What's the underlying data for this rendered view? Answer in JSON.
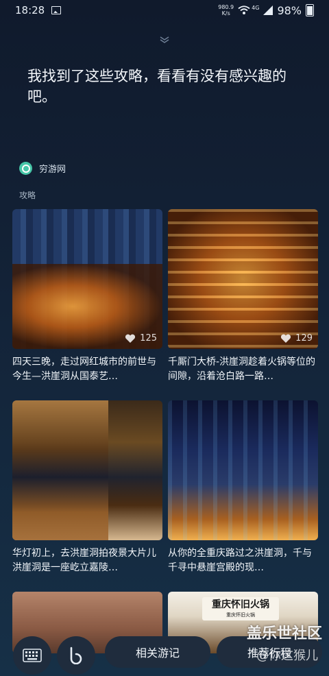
{
  "status_bar": {
    "time": "18:28",
    "net_speed_value": "980.9",
    "net_speed_unit": "K/s",
    "network_type": "4G",
    "battery": "98%"
  },
  "assistant": {
    "message": "我找到了这些攻略，看看有没有感兴趣的吧。"
  },
  "source": {
    "name": "穷游网",
    "section_label": "攻略"
  },
  "cards": [
    {
      "caption": "四天三晚，走过网红城市的前世与今生—洪崖洞从国泰艺…",
      "likes": "125"
    },
    {
      "caption": "千厮门大桥-洪崖洞趁着火锅等位的间隙，沿着沧白路一路…",
      "likes": "129"
    },
    {
      "caption": "华灯初上，去洪崖洞拍夜景大片儿洪崖洞是一座屹立嘉陵…"
    },
    {
      "caption": "从你的全重庆路过之洪崖洞，千与千寻中悬崖宫殿的现…"
    },
    {
      "caption": ""
    },
    {
      "caption": "",
      "sign_title": "重庆怀旧火锅",
      "sign_sub": "重庆怀旧火锅"
    }
  ],
  "bottom_bar": {
    "related_label": "相关游记",
    "recommend_label": "推荐行程"
  },
  "watermark": {
    "line1": "盖乐世社区",
    "line2": "@你这猴儿"
  },
  "icons": {
    "gallery": "image-icon",
    "wifi": "wifi-icon",
    "signal": "signal-icon",
    "battery": "battery-icon",
    "collapse": "chevron-down-icon",
    "keyboard": "keyboard-icon",
    "bixby": "bixby-icon",
    "like": "heart-icon",
    "source_logo": "qyer-logo-icon"
  },
  "colors": {
    "accent_source": "#47c6a8",
    "background_top": "#101a2c",
    "background_bottom": "#163047"
  }
}
